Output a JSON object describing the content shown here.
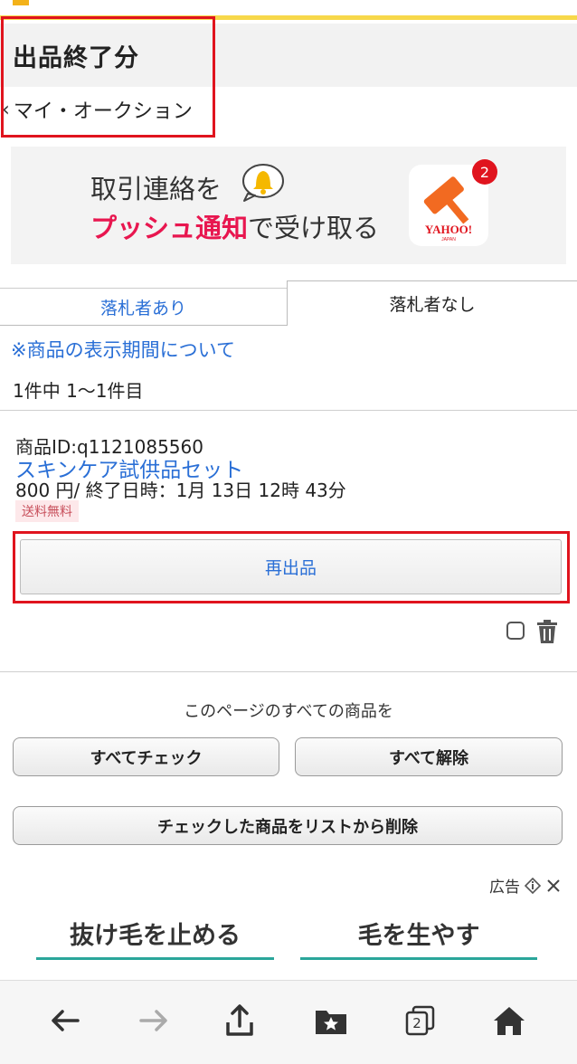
{
  "header": {
    "title": "出品終了分",
    "back_label": "マイ・オークション"
  },
  "promo": {
    "line1": "取引連絡を",
    "line2_highlight": "プッシュ通知",
    "line2_rest": "で受け取る",
    "badge_count": "2",
    "app_brand": "YAHOO!",
    "app_brand_sub": "JAPAN"
  },
  "tabs": [
    {
      "label": "落札者あり",
      "active": false
    },
    {
      "label": "落札者なし",
      "active": true
    }
  ],
  "period_link": "※商品の表示期間について",
  "count_text": "1件中 1〜1件目",
  "item": {
    "id_text": "商品ID:q1121085560",
    "title": "スキンケア試供品セット",
    "price_text": "800 円/ 終了日時：1月 13日 12時 43分",
    "shipping_badge": "送料無料",
    "relist_label": "再出品"
  },
  "bulk": {
    "label": "このページのすべての商品を",
    "check_all": "すべてチェック",
    "uncheck_all": "すべて解除",
    "delete_checked": "チェックした商品をリストから削除"
  },
  "ad": {
    "label": "広告",
    "tab1": "抜け毛を止める",
    "tab2": "毛を生やす"
  },
  "toolbar": {
    "tabs_count": "2"
  },
  "colors": {
    "link": "#2a6fd6",
    "highlight": "#e8164f",
    "annotation": "#e0141e",
    "accent": "#2aa69a"
  }
}
